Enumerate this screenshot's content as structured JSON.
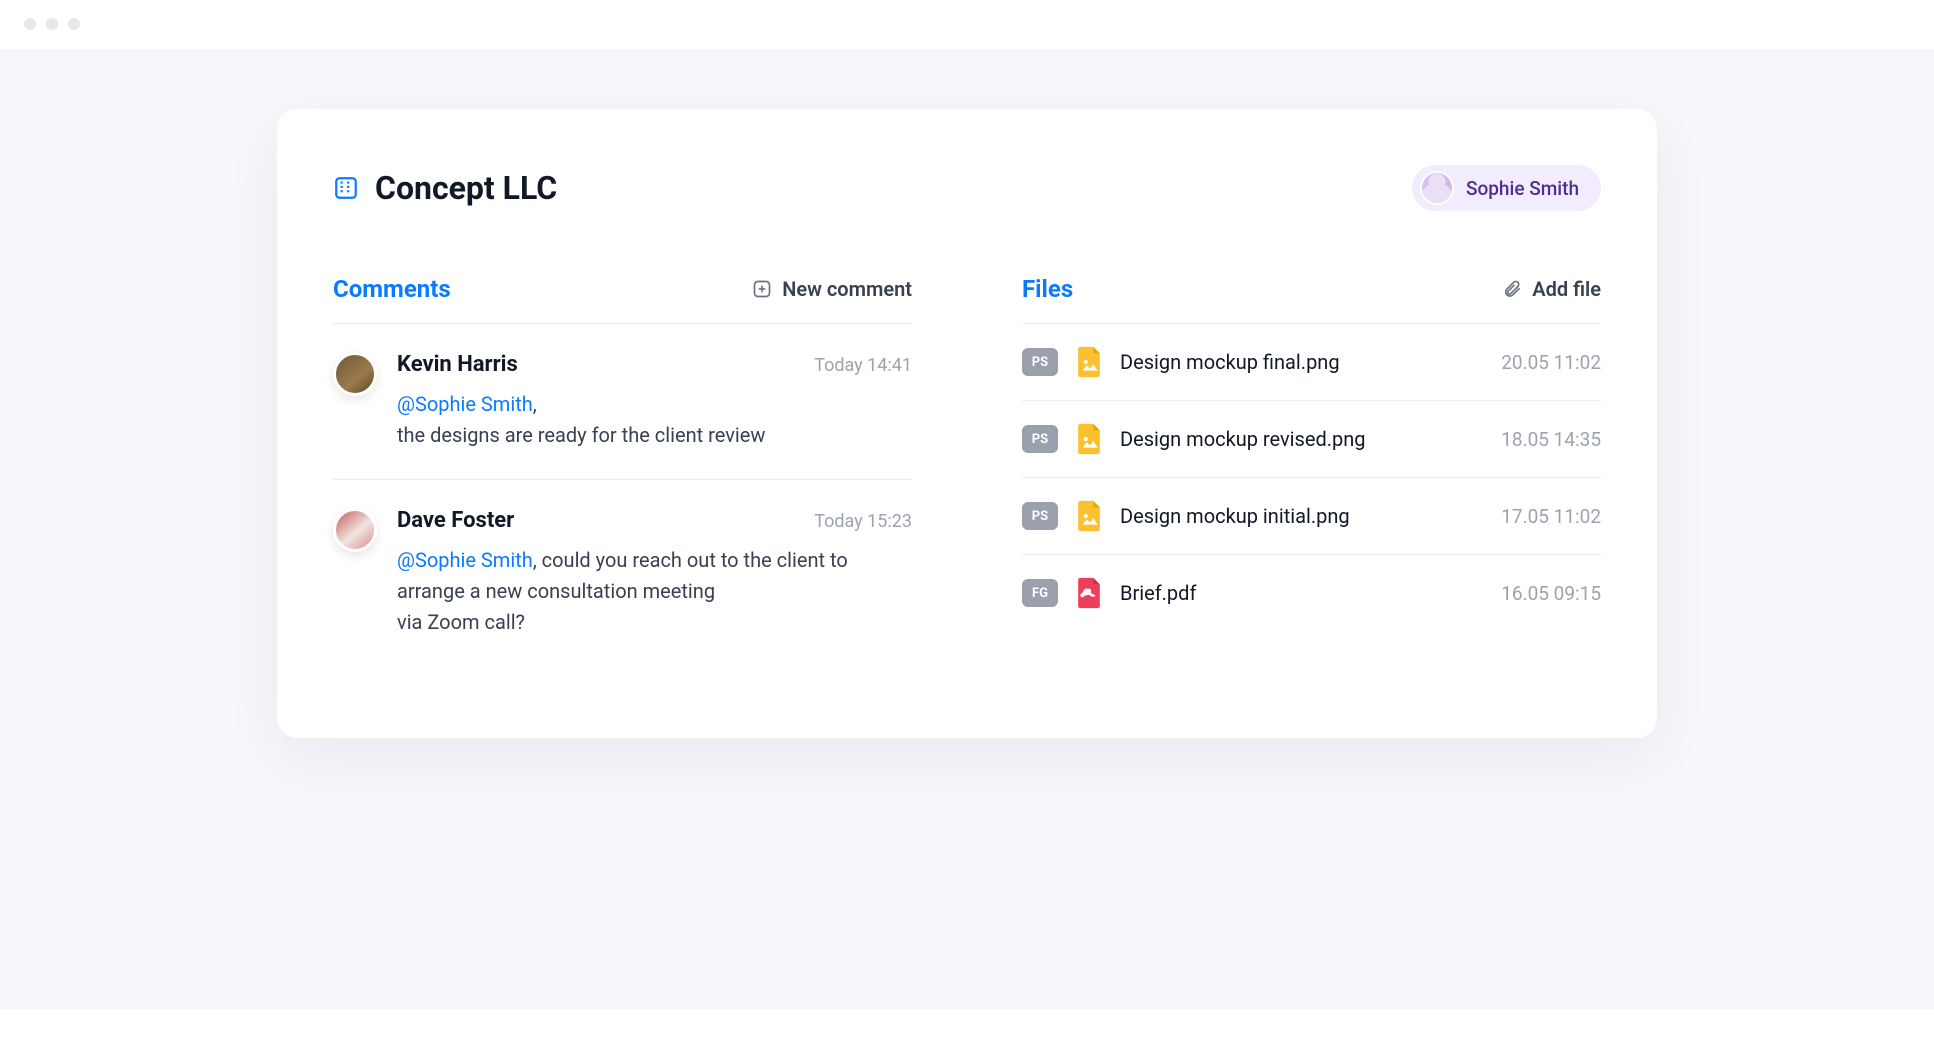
{
  "header": {
    "title": "Concept LLC",
    "user_name": "Sophie Smith"
  },
  "comments_section": {
    "title": "Comments",
    "action_label": "New comment"
  },
  "comments": [
    {
      "author": "Kevin Harris",
      "time": "Today 14:41",
      "mention": "@Sophie Smith",
      "after_mention": ",",
      "line2": "the designs are ready for the client review",
      "line3": ""
    },
    {
      "author": "Dave Foster",
      "time": "Today 15:23",
      "mention": "@Sophie Smith",
      "after_mention": ", could you reach out to the client to",
      "line2": "arrange a new consultation meeting",
      "line3": "via Zoom call?"
    }
  ],
  "files_section": {
    "title": "Files",
    "action_label": "Add file"
  },
  "files": [
    {
      "badge": "PS",
      "name": "Design mockup final.png",
      "time": "20.05 11:02",
      "type": "image"
    },
    {
      "badge": "PS",
      "name": "Design mockup revised.png",
      "time": "18.05 14:35",
      "type": "image"
    },
    {
      "badge": "PS",
      "name": "Design mockup initial.png",
      "time": "17.05 11:02",
      "type": "image"
    },
    {
      "badge": "FG",
      "name": "Brief.pdf",
      "time": "16.05 09:15",
      "type": "pdf"
    }
  ]
}
